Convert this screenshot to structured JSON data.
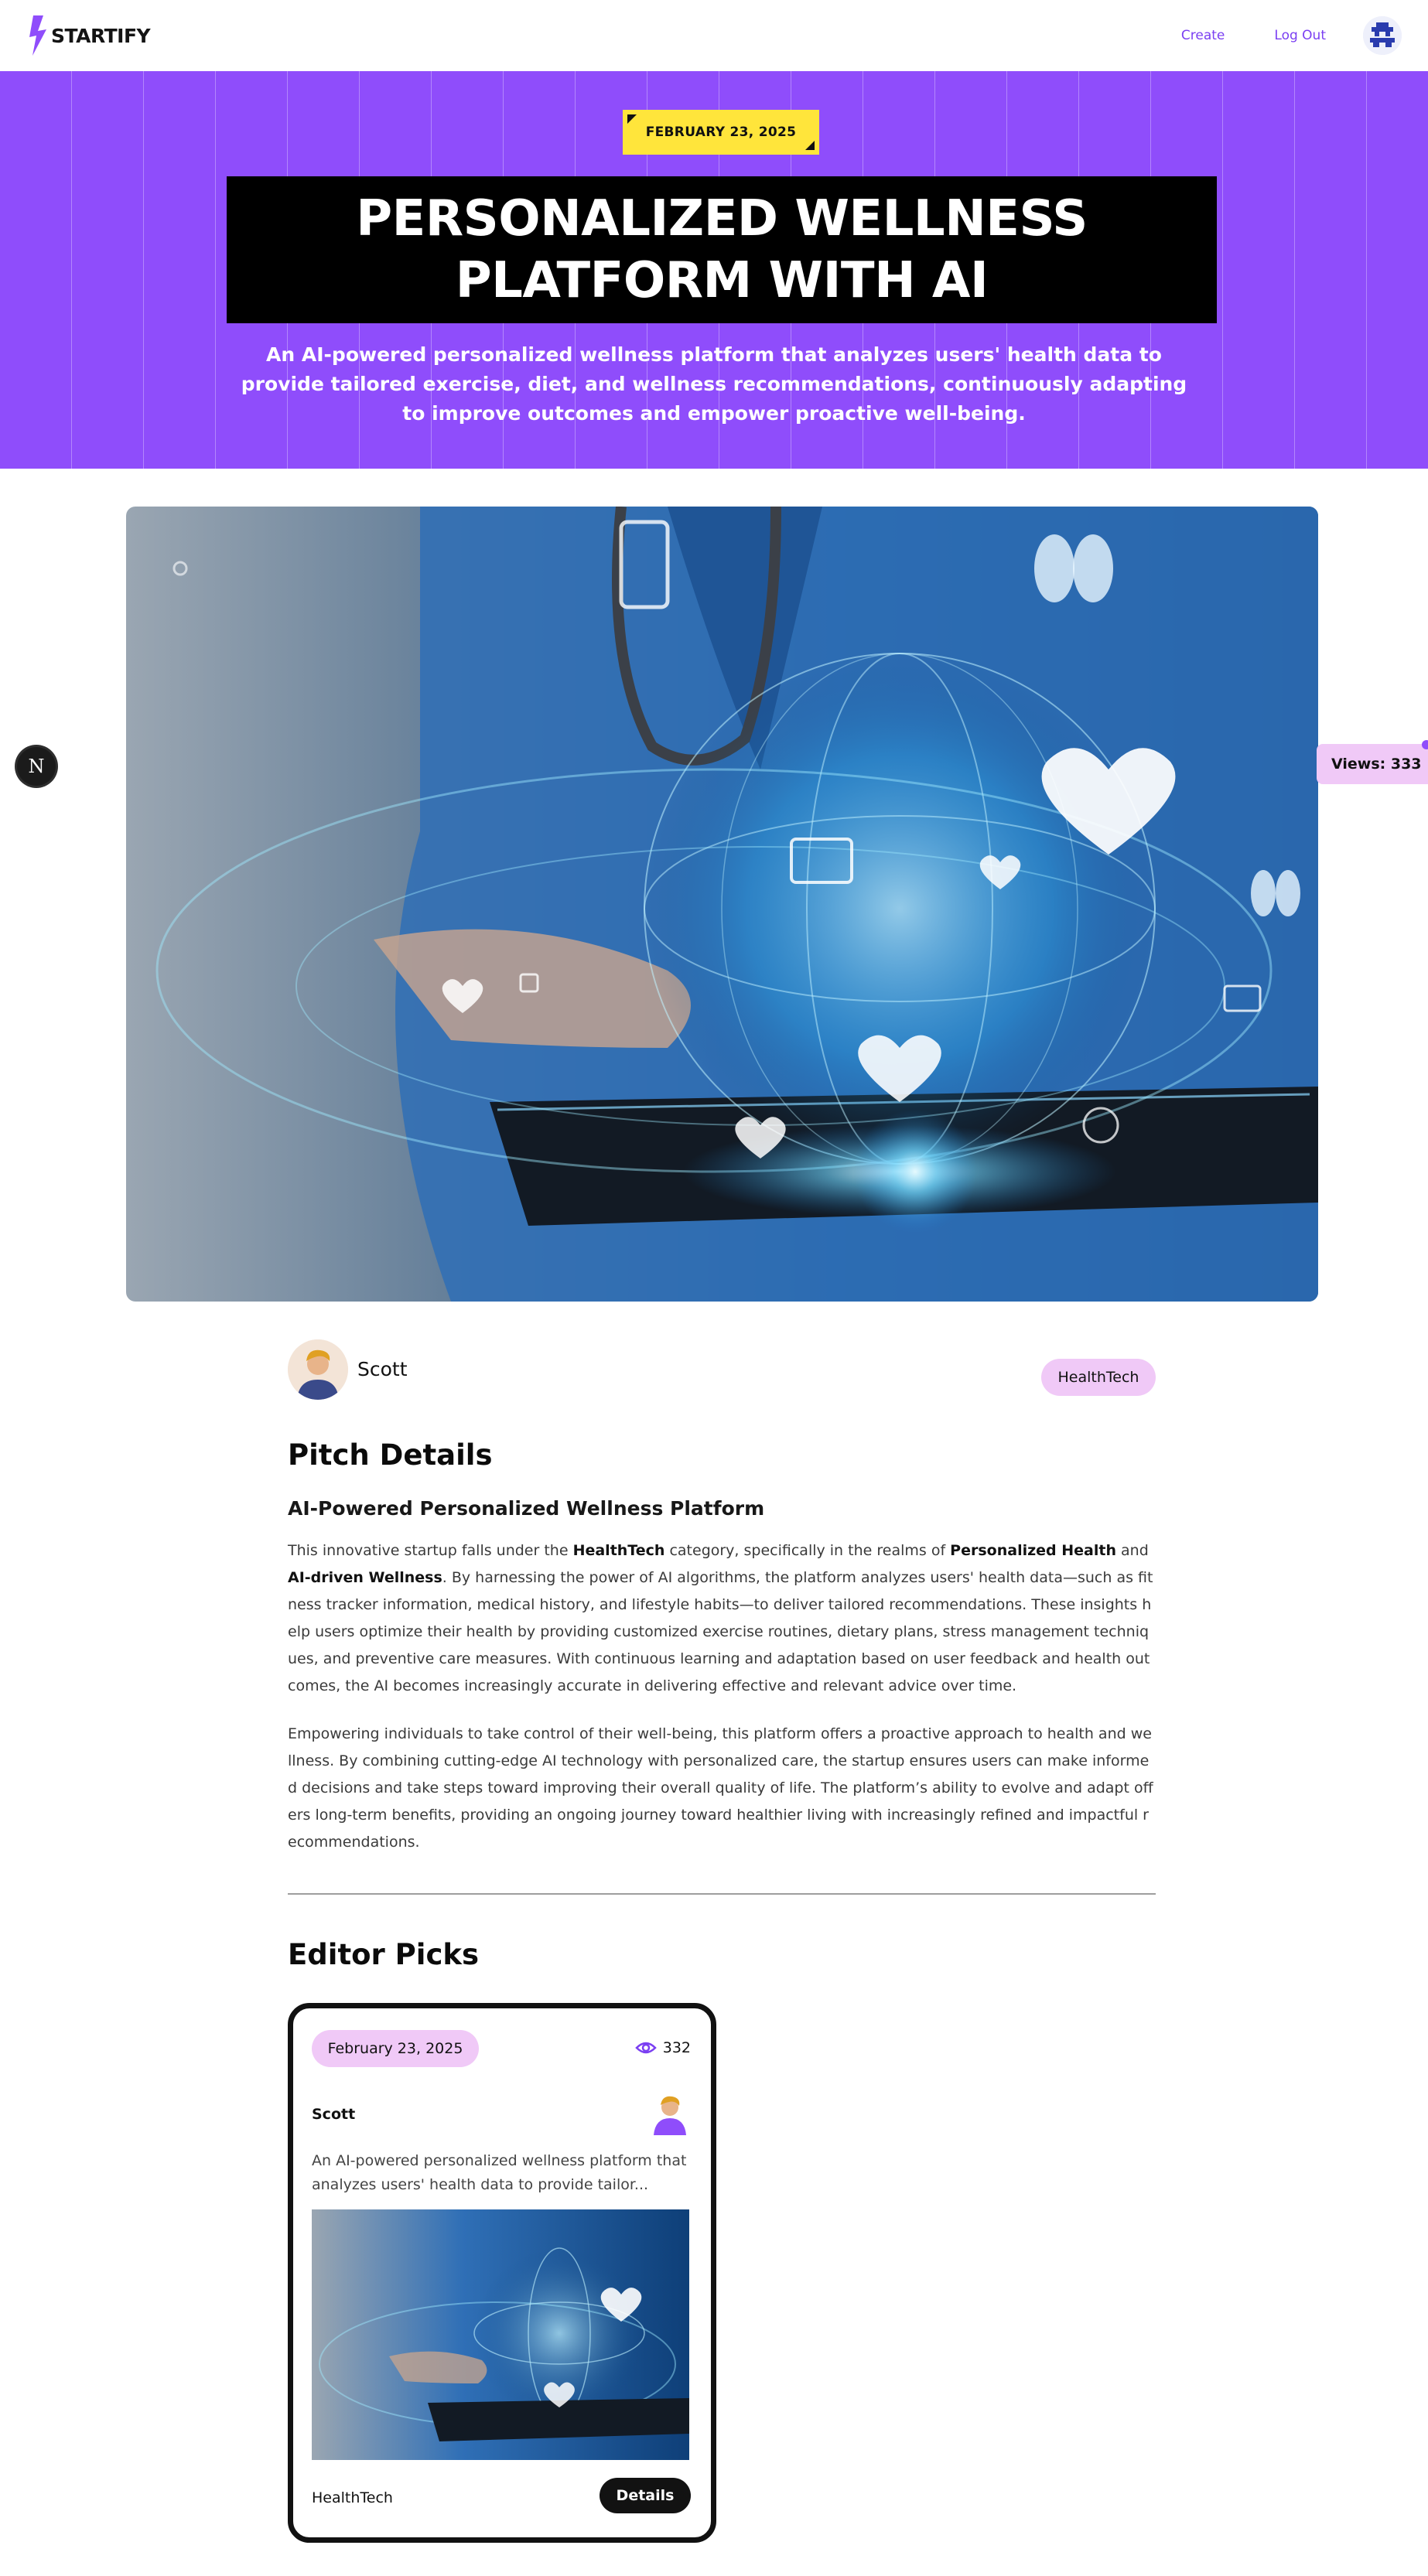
{
  "nav": {
    "logo_text": "STARTIFY",
    "create_label": "Create",
    "logout_label": "Log Out",
    "avatar_icon": "user-avatar-icon"
  },
  "hero": {
    "date": "FEBRUARY 23, 2025",
    "title": "PERSONALIZED WELLNESS PLATFORM WITH AI",
    "description": "An AI-powered personalized wellness platform that analyzes users' health data to provide tailored exercise, diet, and wellness recommendations, continuously adapting to improve outcomes and empower proactive well-being.",
    "background_color": "#8f4dfb",
    "date_tag_color": "#ffe53b"
  },
  "main_image": {
    "icon": "medical-ai-hologram-image"
  },
  "overlay": {
    "nextjs_badge": "N",
    "views_label": "Views: 333"
  },
  "author": {
    "name": "Scott",
    "category": "HealthTech"
  },
  "pitch": {
    "heading": "Pitch Details",
    "subheading": "AI-Powered Personalized Wellness Platform",
    "p1": {
      "t1": "This innovative startup falls under the ",
      "b1": "HealthTech",
      "t2": " category, specifically in the realms of ",
      "b2": "Personalized Health",
      "t3": " and ",
      "b3": "AI-driven Wellness",
      "t4": ". By harnessing the power of AI algorithms, the platform analyzes users' health data—such as fitness tracker information, medical history, and lifestyle habits—to deliver tailored recommendations. These insights help users optimize their health by providing customized exercise routines, dietary plans, stress management techniques, and preventive care measures. With continuous learning and adaptation based on user feedback and health outcomes, the AI becomes increasingly accurate in delivering effective and relevant advice over time."
    },
    "p2": "Empowering individuals to take control of their well-being, this platform offers a proactive approach to health and wellness. By combining cutting-edge AI technology with personalized care, the startup ensures users can make informed decisions and take steps toward improving their overall quality of life. The platform’s ability to evolve and adapt offers long-term benefits, providing an ongoing journey toward healthier living with increasingly refined and impactful recommendations."
  },
  "editor_picks": {
    "heading": "Editor Picks",
    "cards": [
      {
        "date": "February 23, 2025",
        "views": "332",
        "author": "Scott",
        "description": "An AI-powered personalized wellness platform that analyzes users' health data to provide tailor...",
        "category": "HealthTech",
        "details_label": "Details"
      }
    ]
  },
  "colors": {
    "accent": "#7b3ff2",
    "pill": "#f0c9f7",
    "dark": "#111111"
  }
}
